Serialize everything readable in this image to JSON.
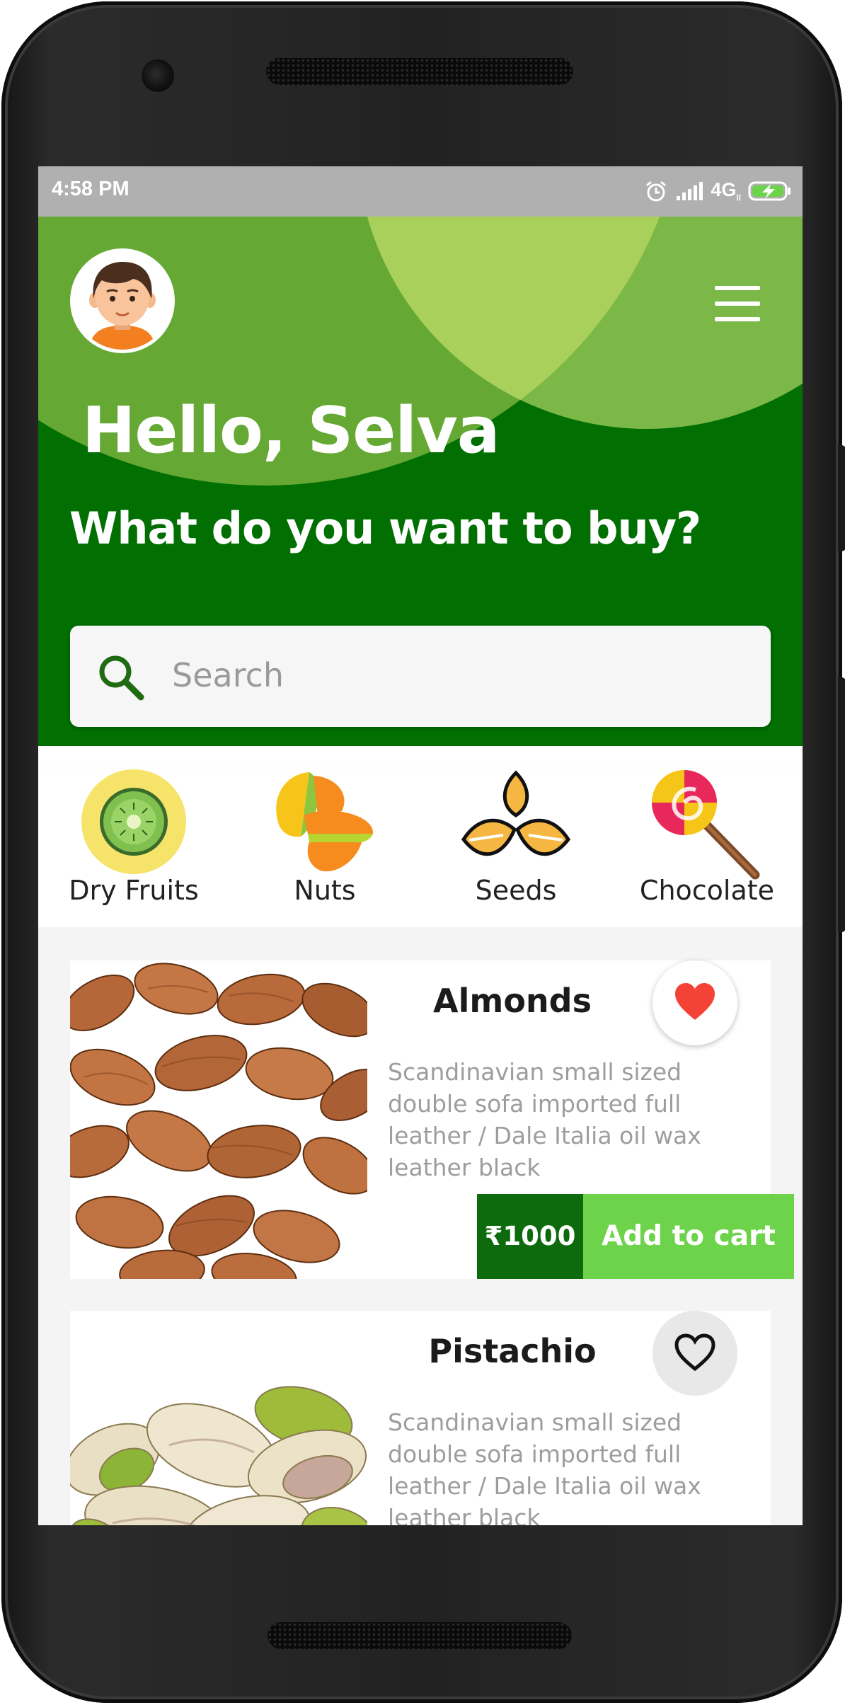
{
  "status_bar": {
    "time": "4:58 PM",
    "network": "4G",
    "network_sub": "ll",
    "icons": [
      "alarm-icon",
      "signal-icon",
      "battery-charging-icon"
    ]
  },
  "header": {
    "greeting": "Hello, Selva",
    "prompt": "What do you want to buy?",
    "avatar_icon": "boy-avatar",
    "menu_icon": "hamburger-menu-icon"
  },
  "search": {
    "placeholder": "Search",
    "value": "",
    "icon": "search-icon"
  },
  "categories": [
    {
      "label": "Dry Fruits",
      "icon": "kiwi-icon",
      "selected": true
    },
    {
      "label": "Nuts",
      "icon": "pistachio-icon",
      "selected": false
    },
    {
      "label": "Seeds",
      "icon": "seeds-icon",
      "selected": false
    },
    {
      "label": "Chocolate",
      "icon": "lollipop-icon",
      "selected": false
    }
  ],
  "products": [
    {
      "name": "Almonds",
      "description": "Scandinavian small sized double sofa imported full leather / Dale Italia oil wax leather black",
      "price": "₹1000",
      "add_label": "Add to cart",
      "favorite": true,
      "image": "almonds-photo"
    },
    {
      "name": "Pistachio",
      "description": "Scandinavian small sized double sofa imported full leather / Dale Italia oil wax leather black",
      "favorite": false,
      "image": "pistachio-photo"
    }
  ],
  "colors": {
    "header_dark_green": "#016f01",
    "header_green": "#65a834",
    "header_light_green": "#a9d05a",
    "price_green": "#0d6b0d",
    "add_to_cart_green": "#6cd34a",
    "favorite_red": "#f44336"
  }
}
